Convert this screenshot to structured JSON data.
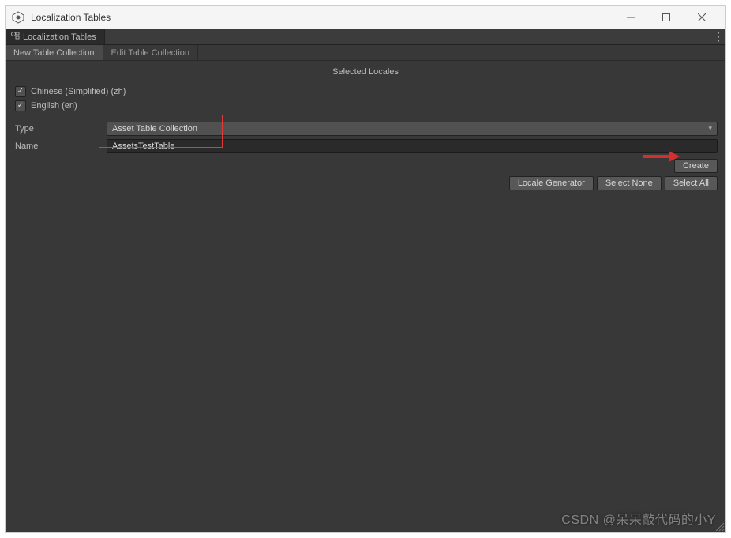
{
  "window": {
    "title": "Localization Tables"
  },
  "doc_tab": {
    "label": "Localization Tables"
  },
  "sub_tabs": {
    "new": "New Table Collection",
    "edit": "Edit Table Collection"
  },
  "section_title": "Selected Locales",
  "locales": [
    {
      "label": "Chinese (Simplified) (zh)",
      "checked": true
    },
    {
      "label": "English (en)",
      "checked": true
    }
  ],
  "form": {
    "type_label": "Type",
    "type_value": "Asset Table Collection",
    "name_label": "Name",
    "name_value": "AssetsTestTable"
  },
  "buttons": {
    "create": "Create",
    "locale_generator": "Locale Generator",
    "select_none": "Select None",
    "select_all": "Select All"
  },
  "watermark": "CSDN @呆呆敲代码的小Y"
}
